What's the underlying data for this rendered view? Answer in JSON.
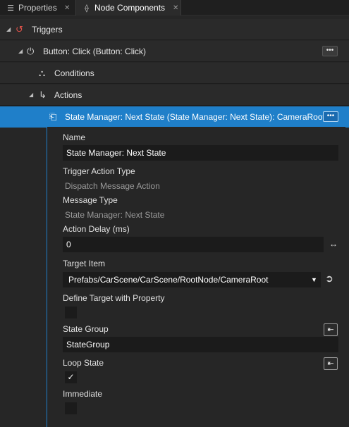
{
  "tabs": [
    {
      "label": "Properties",
      "icon": "list-icon",
      "active": false
    },
    {
      "label": "Node Components",
      "icon": "components-icon",
      "active": true
    }
  ],
  "tree": {
    "triggers": {
      "label": "Triggers",
      "icon": "trigger-icon"
    },
    "button_click": {
      "label": "Button: Click (Button: Click)",
      "icon": "click-icon",
      "menu": "•••"
    },
    "conditions": {
      "label": "Conditions",
      "icon": "conditions-icon"
    },
    "actions": {
      "label": "Actions",
      "icon": "actions-icon"
    },
    "selected_action": {
      "label": "State Manager: Next State (State Manager: Next State): CameraRoot",
      "icon": "dispatch-icon",
      "menu": "•••"
    }
  },
  "properties": {
    "name": {
      "label": "Name",
      "value": "State Manager: Next State"
    },
    "trigger_action_type": {
      "label": "Trigger Action Type",
      "value": "Dispatch Message Action"
    },
    "message_type": {
      "label": "Message Type",
      "value": "State Manager: Next State"
    },
    "action_delay": {
      "label": "Action Delay (ms)",
      "value": "0"
    },
    "target_item": {
      "label": "Target Item",
      "value": "Prefabs/CarScene/CarScene/RootNode/CameraRoot"
    },
    "define_target": {
      "label": "Define Target with Property",
      "checked": false
    },
    "state_group": {
      "label": "State Group",
      "value": "StateGroup"
    },
    "loop_state": {
      "label": "Loop State",
      "checked": true
    },
    "immediate": {
      "label": "Immediate",
      "checked": false
    }
  },
  "colors": {
    "selection": "#1f7fc9",
    "background": "#262626",
    "field": "#1b1b1b"
  }
}
